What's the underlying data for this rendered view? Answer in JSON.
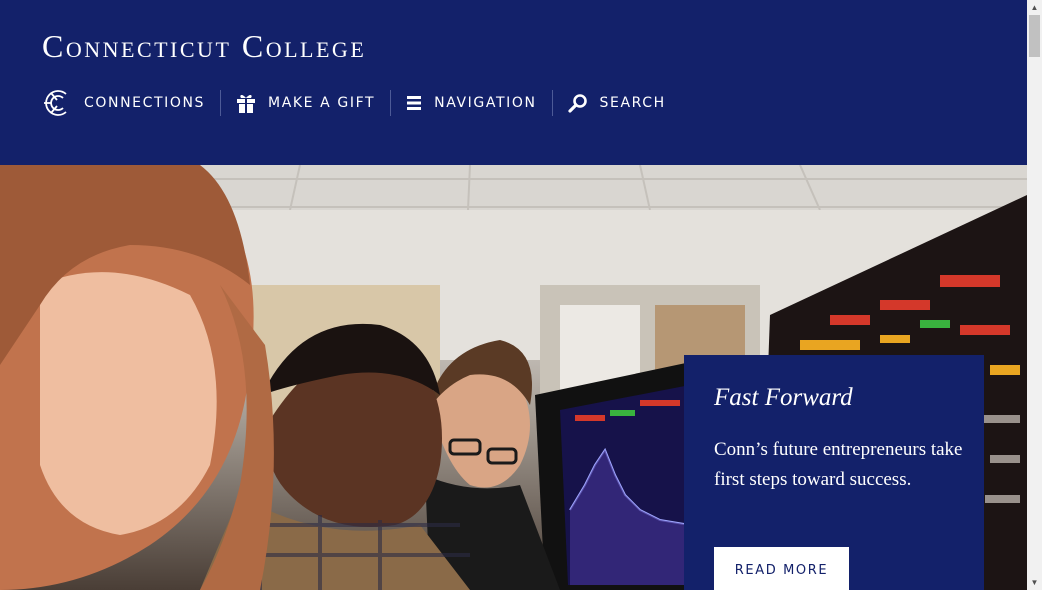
{
  "header": {
    "site_title": "Connecticut College",
    "background_color": "#13216a",
    "nav": [
      {
        "label": "CONNECTIONS",
        "icon": "connections-logo-icon"
      },
      {
        "label": "MAKE A GIFT",
        "icon": "gift-icon"
      },
      {
        "label": "NAVIGATION",
        "icon": "hamburger-menu-icon"
      },
      {
        "label": "SEARCH",
        "icon": "search-icon"
      }
    ]
  },
  "hero": {
    "image_alt": "",
    "feature": {
      "title": "Fast Forward",
      "text": "Conn’s future entrepreneurs take first steps toward success.",
      "button_label": "READ MORE"
    }
  },
  "scrollbar": {
    "up_arrow": "▲",
    "down_arrow": "▼"
  }
}
